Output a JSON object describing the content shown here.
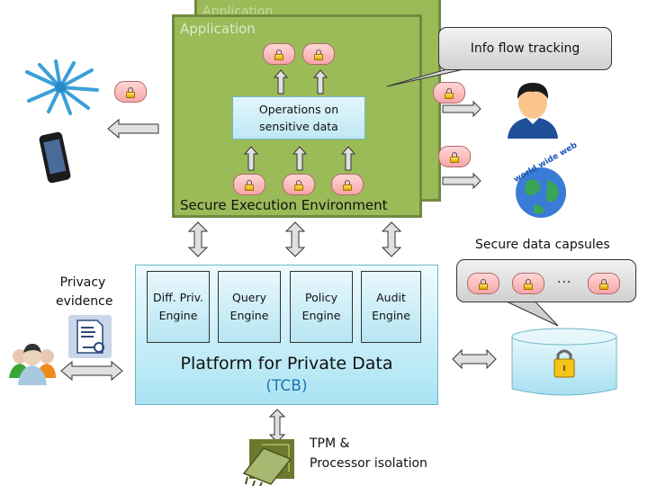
{
  "application_windows": {
    "back_title": "Application",
    "front_title": "Application",
    "environment_label": "Secure Execution Environment"
  },
  "operations_box": {
    "line1": "Operations on",
    "line2": "sensitive data"
  },
  "info_flow_callout": "Info flow tracking",
  "secure_data_capsules": {
    "label": "Secure data capsules",
    "ellipsis": "..."
  },
  "platform": {
    "title": "Platform for Private Data",
    "subtitle": "(TCB)",
    "engines": [
      {
        "line1": "Diff. Priv.",
        "line2": "Engine"
      },
      {
        "line1": "Query",
        "line2": "Engine"
      },
      {
        "line1": "Policy",
        "line2": "Engine"
      },
      {
        "line1": "Audit",
        "line2": "Engine"
      }
    ]
  },
  "privacy_evidence": {
    "line1": "Privacy",
    "line2": "evidence"
  },
  "hardware": {
    "line1": "TPM &",
    "line2": "Processor isolation"
  },
  "colors": {
    "app_green": "#9bbb59",
    "app_border": "#71893f",
    "platform_blue": "#a9e3f3",
    "capsule_pink": "#f6a7a7",
    "tcb_blue": "#1f74b3"
  },
  "icons": {
    "social_network": "social-network-icon",
    "phone": "smartphone-icon",
    "person": "person-icon",
    "globe": "world-wide-web-globe-icon",
    "users": "user-group-icon",
    "certificate": "certificate-key-icon",
    "chip": "processor-chip-icon",
    "database": "database-icon",
    "lock": "lock-icon"
  }
}
